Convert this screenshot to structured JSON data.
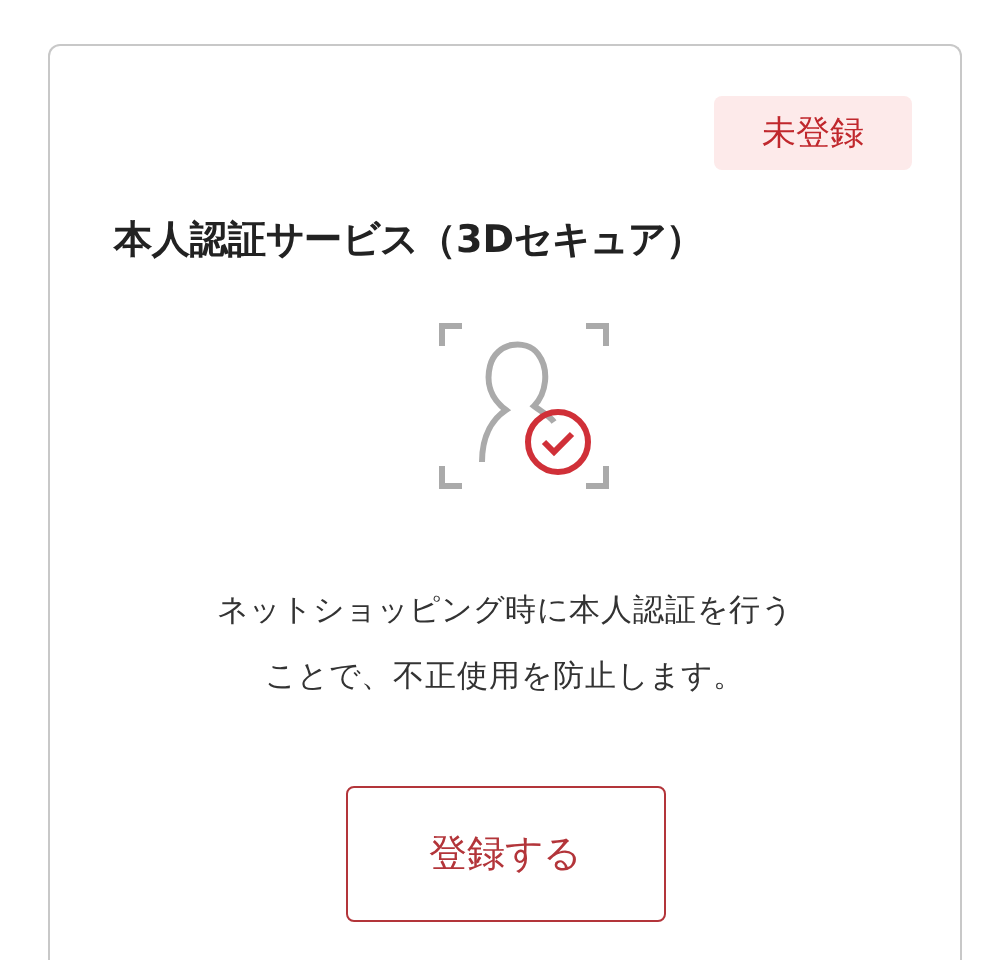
{
  "card": {
    "status_badge": "未登録",
    "title": "本人認証サービス（3Dセキュア）",
    "description_lines": [
      "ネットショッピング時に本人認証を行う",
      "ことで、不正使用を防止します。"
    ],
    "button": "登録する"
  }
}
